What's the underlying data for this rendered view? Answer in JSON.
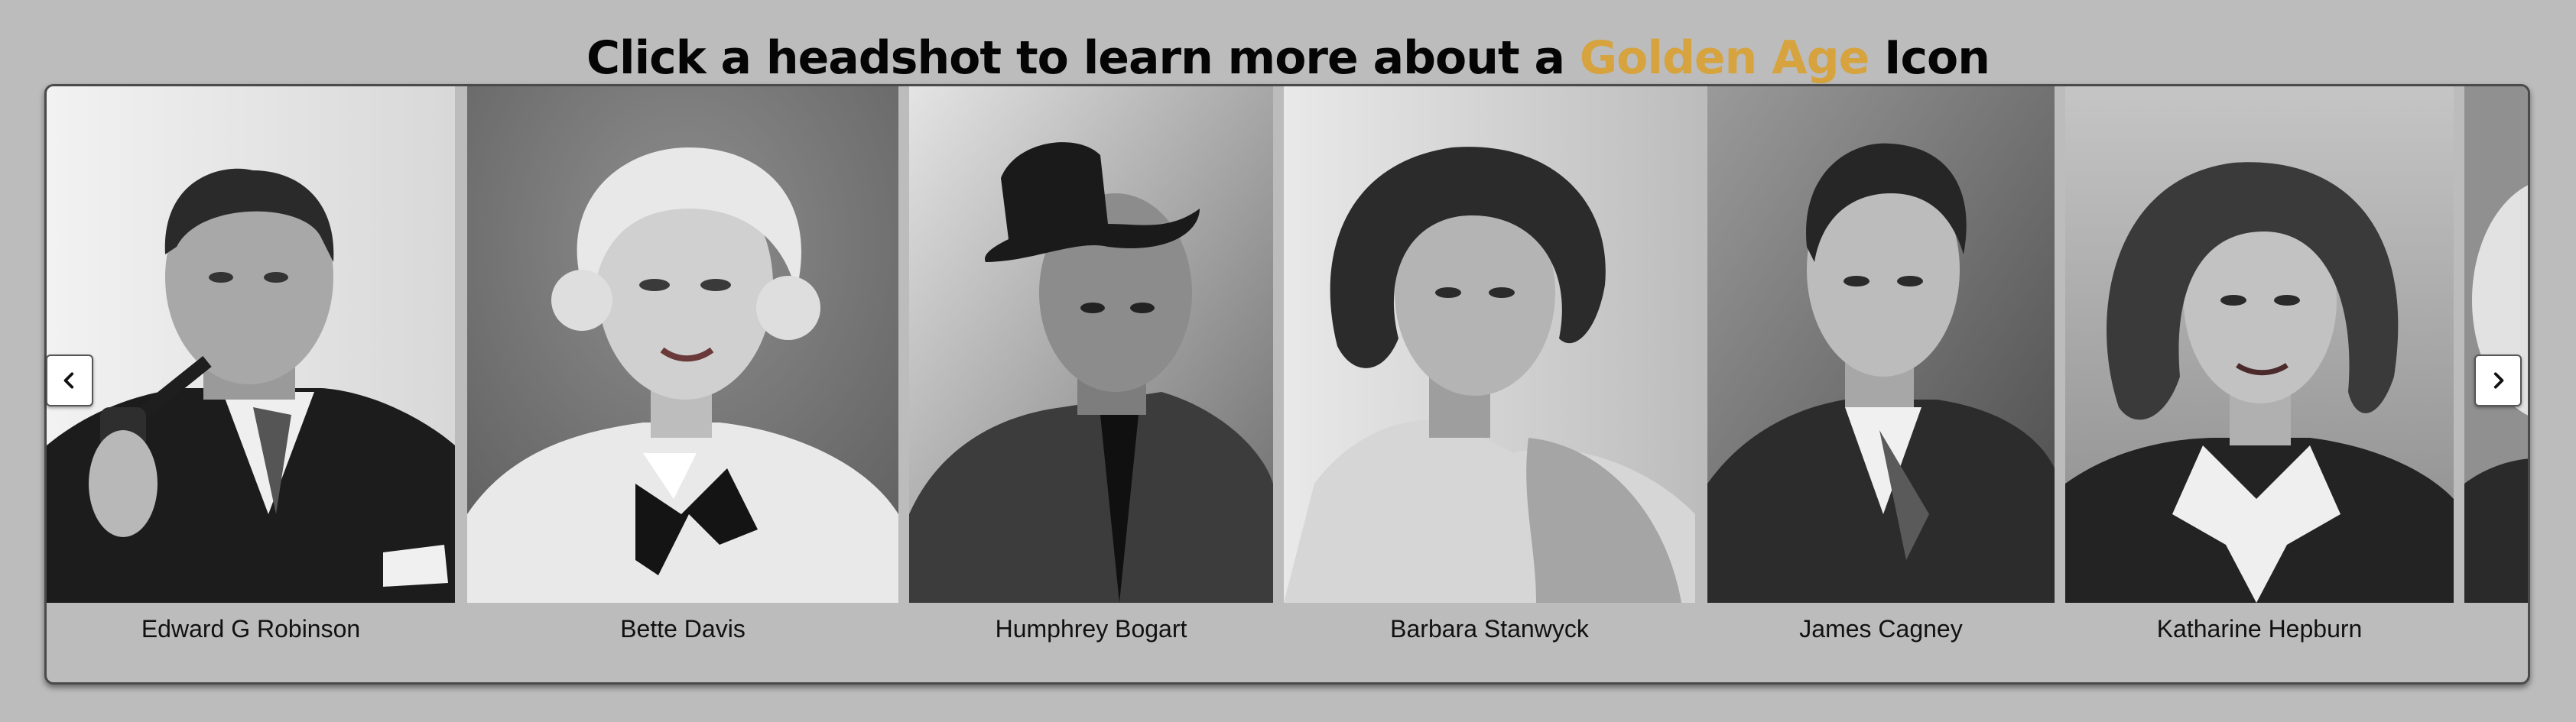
{
  "header": {
    "title_prefix": "Click a headshot to learn more about a ",
    "title_accent": "Golden Age",
    "title_suffix": " Icon",
    "accent_color": "#d6a33e"
  },
  "carousel": {
    "prev_icon": "chevron-left-icon",
    "next_icon": "chevron-right-icon",
    "items": [
      {
        "name": "Edward G Robinson"
      },
      {
        "name": "Bette Davis"
      },
      {
        "name": "Humphrey Bogart"
      },
      {
        "name": "Barbara Stanwyck"
      },
      {
        "name": "James Cagney"
      },
      {
        "name": "Katharine Hepburn"
      },
      {
        "name": ""
      }
    ]
  }
}
